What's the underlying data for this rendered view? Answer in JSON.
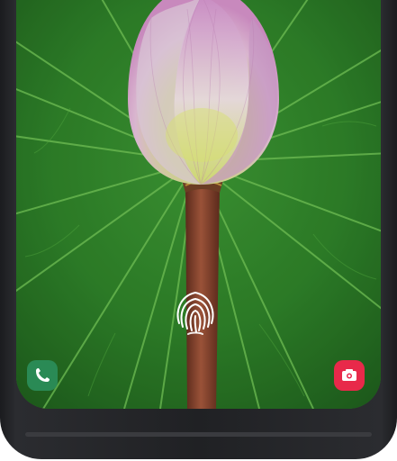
{
  "lock_screen": {
    "wallpaper": "lotus-bud-on-green-leaf",
    "fingerprint_icon": "fingerprint-icon",
    "shortcuts": {
      "left": {
        "icon": "phone-icon",
        "color": "#2a8a55"
      },
      "right": {
        "icon": "camera-icon",
        "color": "#e8294a"
      }
    }
  }
}
